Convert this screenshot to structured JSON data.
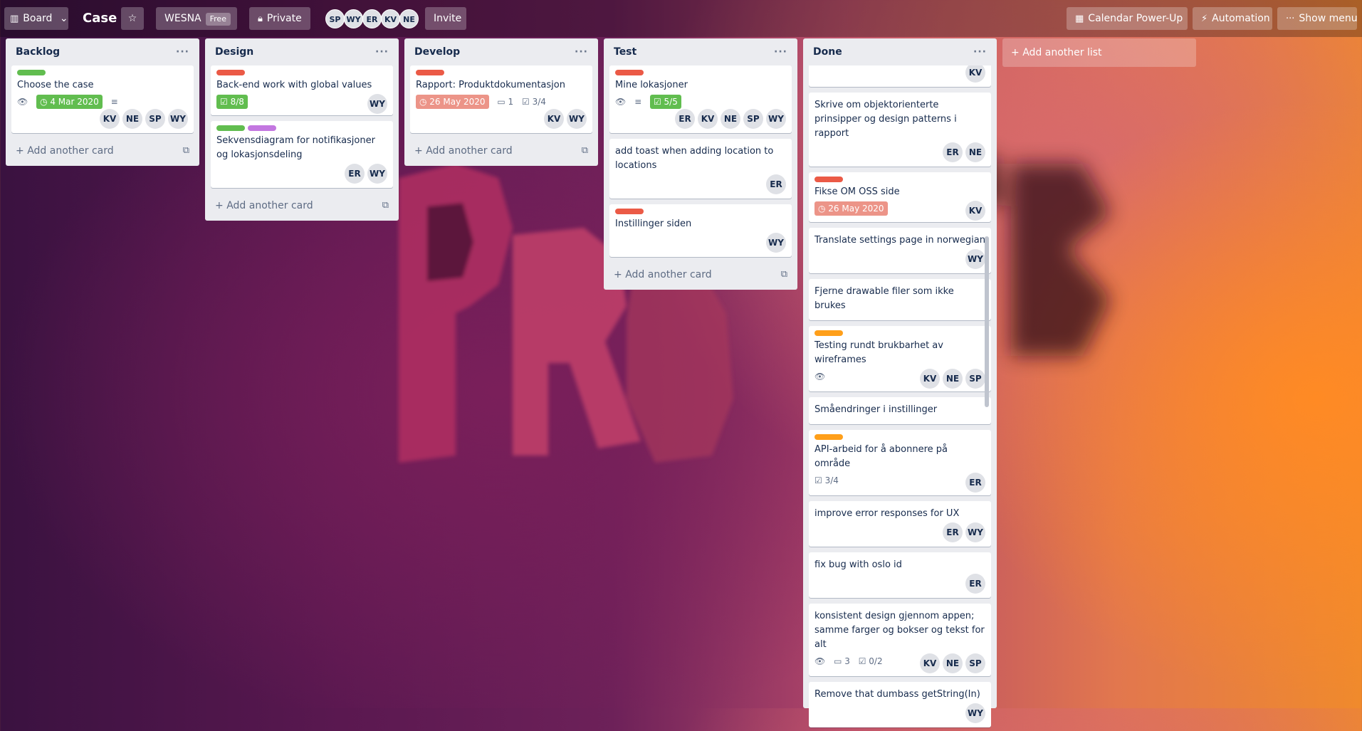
{
  "header": {
    "board_switcher_label": "Board",
    "board_name": "Case",
    "workspace_name": "WESNA",
    "workspace_plan": "Free",
    "visibility_label": "Private",
    "members": [
      "SP",
      "WY",
      "ER",
      "KV",
      "NE"
    ],
    "invite_label": "Invite",
    "calendar_label": "Calendar Power-Up",
    "automation_label": "Automation",
    "show_menu_label": "Show menu"
  },
  "lists": {
    "backlog": {
      "title": "Backlog",
      "add_card_label": "Add another card",
      "cards": [
        {
          "title": "Choose the case",
          "labels": [
            "#61bd4f"
          ],
          "due": "4 Mar 2020",
          "members": [
            "KV",
            "NE",
            "SP",
            "WY"
          ]
        }
      ]
    },
    "design": {
      "title": "Design",
      "add_card_label": "Add another card",
      "cards": [
        {
          "title": "Back-end work with global values",
          "labels": [
            "#eb5a46"
          ],
          "checklist": "8/8",
          "members": [
            "WY"
          ]
        },
        {
          "title": "Sekvensdiagram for notifikasjoner og lokasjonsdeling",
          "labels": [
            "#61bd4f",
            "#c377e0"
          ],
          "members": [
            "ER",
            "WY"
          ]
        }
      ]
    },
    "develop": {
      "title": "Develop",
      "add_card_label": "Add another card",
      "cards": [
        {
          "title": "Rapport: Produktdokumentasjon",
          "labels": [
            "#eb5a46"
          ],
          "due": "26 May 2020",
          "comments": "1",
          "checklist": "3/4",
          "members": [
            "KV",
            "WY"
          ]
        }
      ]
    },
    "test": {
      "title": "Test",
      "add_card_label": "Add another card",
      "cards": [
        {
          "title": "Mine lokasjoner",
          "labels": [
            "#eb5a46"
          ],
          "checklist": "5/5",
          "members": [
            "ER",
            "KV",
            "NE",
            "SP",
            "WY"
          ]
        },
        {
          "title": "add toast when adding location to locations",
          "labels": [],
          "members": [
            "ER"
          ]
        },
        {
          "title": "Instillinger siden",
          "labels": [
            "#eb5a46"
          ],
          "members": [
            "WY"
          ]
        }
      ]
    },
    "done": {
      "title": "Done",
      "cards": [
        {
          "title": "",
          "labels": [],
          "members": [
            "KV"
          ]
        },
        {
          "title": "Skrive om objektorienterte prinsipper og design patterns i rapport",
          "labels": [],
          "members": [
            "ER",
            "NE"
          ]
        },
        {
          "title": "Fikse OM OSS side",
          "labels": [
            "#eb5a46"
          ],
          "due": "26 May 2020",
          "members": [
            "KV"
          ]
        },
        {
          "title": "Translate settings page in norwegian",
          "labels": [],
          "members": [
            "WY"
          ]
        },
        {
          "title": "Fjerne drawable filer som ikke brukes",
          "labels": [],
          "members": []
        },
        {
          "title": "Testing rundt brukbarhet av wireframes",
          "labels": [
            "#ff9f1a"
          ],
          "members": [
            "KV",
            "NE",
            "SP"
          ]
        },
        {
          "title": "Småendringer i instillinger",
          "labels": [],
          "members": []
        },
        {
          "title": "API-arbeid for å abonnere på område",
          "labels": [
            "#ff9f1a"
          ],
          "checklist": "3/4",
          "members": [
            "ER"
          ]
        },
        {
          "title": "improve error responses for UX",
          "labels": [],
          "members": [
            "ER",
            "WY"
          ]
        },
        {
          "title": "fix bug with oslo id",
          "labels": [],
          "members": [
            "ER"
          ]
        },
        {
          "title": "konsistent design gjennom appen; samme farger og bokser og tekst for alt",
          "labels": [],
          "comments": "3",
          "checklist": "0/2",
          "members": [
            "KV",
            "NE",
            "SP"
          ]
        },
        {
          "title": "Remove that dumbass getString(In)",
          "labels": [],
          "members": [
            "WY"
          ]
        }
      ]
    }
  },
  "add_list_label": "Add another list",
  "icons": {
    "board": "board-icon",
    "chevron": "chevron-down-icon",
    "star": "star-icon",
    "lock": "lock-icon",
    "calendar": "calendar-icon",
    "bolt": "bolt-icon",
    "more": "more-icon",
    "eye": "eye-icon",
    "clock": "clock-icon",
    "checklist": "checklist-icon",
    "comment": "comment-icon",
    "description": "description-icon",
    "plus": "plus-icon",
    "template": "template-icon"
  },
  "colors": {
    "green": "#61bd4f",
    "red": "#eb5a46",
    "purple": "#c377e0",
    "orange": "#ff9f1a"
  }
}
